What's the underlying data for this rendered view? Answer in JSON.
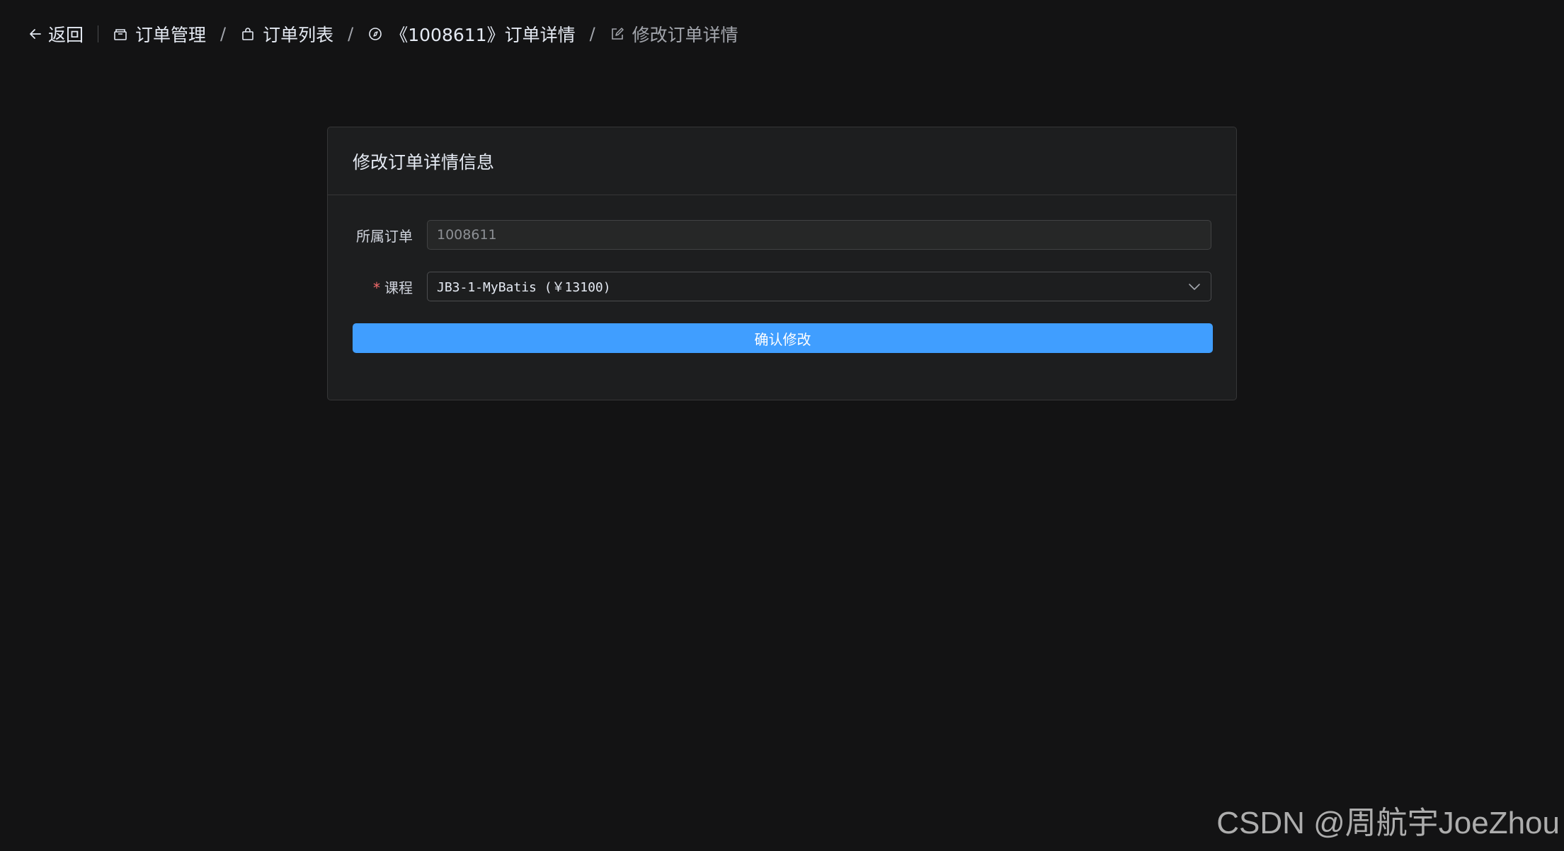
{
  "header": {
    "back_label": "返回",
    "breadcrumb": [
      {
        "label": "订单管理",
        "icon": "box-icon"
      },
      {
        "label": "订单列表",
        "icon": "bag-icon"
      },
      {
        "label": "《1008611》订单详情",
        "icon": "compass-icon"
      },
      {
        "label": "修改订单详情",
        "icon": "edit-icon"
      }
    ],
    "separator": "/"
  },
  "card": {
    "title": "修改订单详情信息",
    "order_field": {
      "label": "所属订单",
      "value": "1008611"
    },
    "course_field": {
      "required_mark": "*",
      "label": "课程",
      "value": "JB3-1-MyBatis (￥13100)"
    },
    "submit_label": "确认修改"
  },
  "watermark": "CSDN @周航宇JoeZhou",
  "colors": {
    "background": "#131314",
    "card": "#1d1e1f",
    "primary": "#409eff",
    "required": "#f56c6c"
  }
}
